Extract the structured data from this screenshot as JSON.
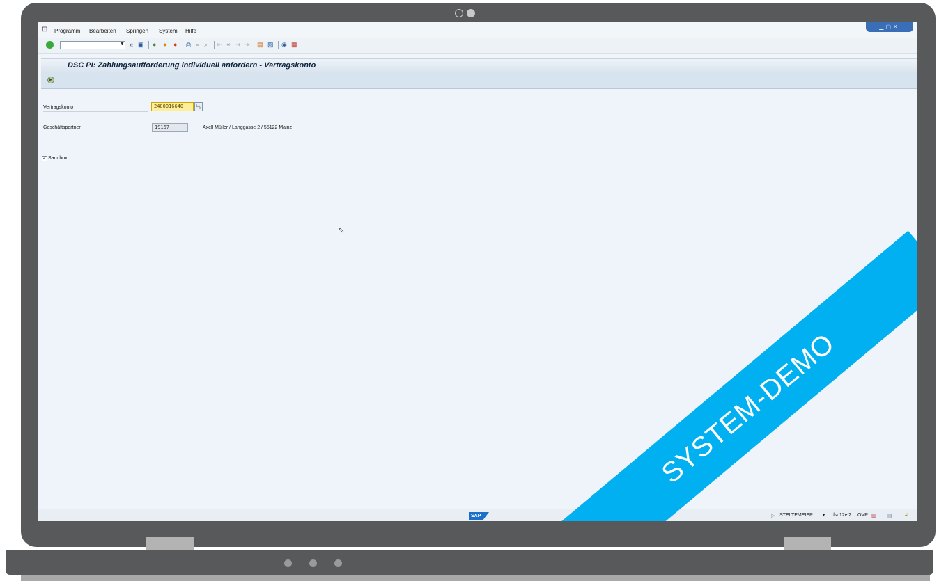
{
  "menu": {
    "items": [
      "Programm",
      "Bearbeiten",
      "Springen",
      "System",
      "Hilfe"
    ]
  },
  "toolbar": {
    "command_value": "",
    "back_glyph": "«"
  },
  "screen": {
    "title": "DSC PI: Zahlungsaufforderung individuell anfordern - Vertragskonto"
  },
  "form": {
    "vertragskonto_label": "Vertragskonto",
    "vertragskonto_value": "2400016640",
    "geschaeftspartner_label": "Geschäftspartner",
    "geschaeftspartner_value": "19167",
    "geschaeftspartner_desc": "Axell Müller / Langgasse 2 / 55122 Mainz",
    "sandbox_label": "Sandbox",
    "sandbox_checked": true
  },
  "status": {
    "sap_logo": "SAP",
    "user": "STELTEMEIER",
    "system": "dsc12el2",
    "mode": "OVR"
  },
  "banner": {
    "text": "SYSTEM-DEMO"
  },
  "colors": {
    "banner": "#00b0f0",
    "frame": "#58595b",
    "required_field": "#ffee99"
  }
}
